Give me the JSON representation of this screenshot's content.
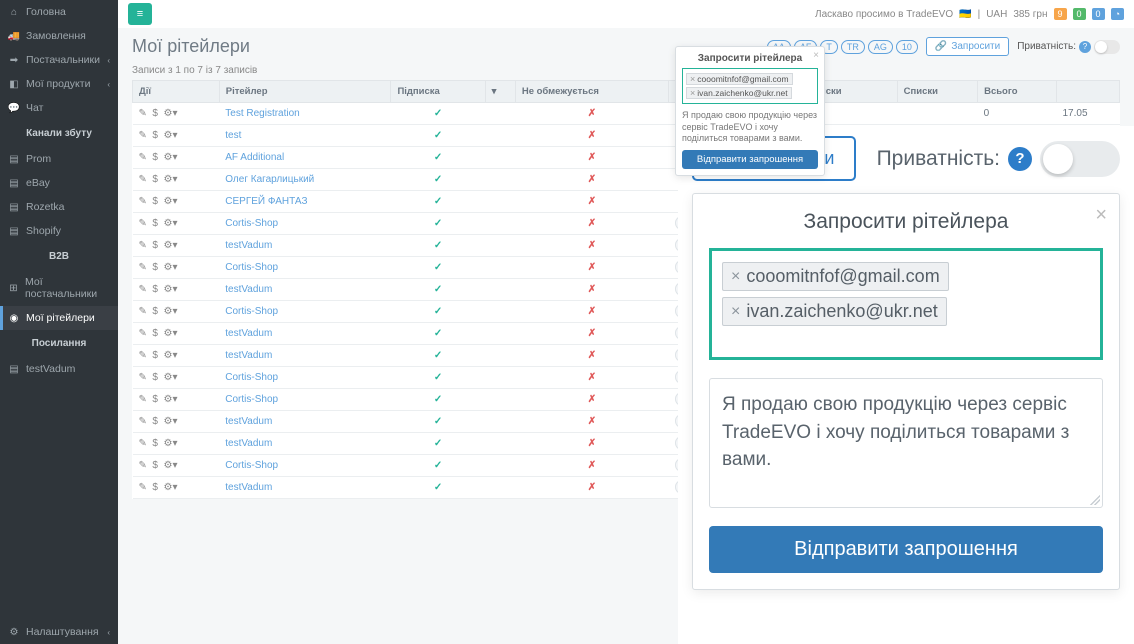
{
  "sidebar": {
    "items": [
      {
        "icon": "⌂",
        "label": "Головна"
      },
      {
        "icon": "🚚",
        "label": "Замовлення"
      },
      {
        "icon": "➡",
        "label": "Постачальники",
        "chev": "‹"
      },
      {
        "icon": "◧",
        "label": "Мої продукти",
        "chev": "‹"
      },
      {
        "icon": "💬",
        "label": "Чат"
      }
    ],
    "header1": "Канали збуту",
    "channels": [
      {
        "icon": "▤",
        "label": "Prom"
      },
      {
        "icon": "▤",
        "label": "eBay"
      },
      {
        "icon": "▤",
        "label": "Rozetka"
      },
      {
        "icon": "▤",
        "label": "Shopify"
      }
    ],
    "header2": "B2B",
    "b2b": [
      {
        "icon": "⊞",
        "label": "Мої постачальники"
      },
      {
        "icon": "◉",
        "label": "Мої рітейлери",
        "active": true
      }
    ],
    "header3": "Посилання",
    "links": [
      {
        "icon": "▤",
        "label": "testVadum"
      }
    ],
    "bottom": {
      "icon": "⚙",
      "label": "Налаштування",
      "chev": "‹"
    }
  },
  "topbar": {
    "welcome": "Ласкаво просимо в TradeEVO",
    "flag": "🇺🇦",
    "currency": "UAH",
    "amount": "385 грн",
    "notifs": [
      "9",
      "0",
      "0"
    ]
  },
  "page": {
    "title": "Мої рітейлери",
    "chips": [
      "AA",
      "AF",
      "T",
      "TR",
      "AG",
      "10"
    ],
    "invite_btn": "Запросити",
    "privacy_label": "Приватність:",
    "records": "Записи з 1 по 7 із 7 записів"
  },
  "table": {
    "headers": [
      "Дії",
      "Рітейлер",
      "Підписка",
      "",
      "Не обмежується",
      "",
      "",
      "тів в списки",
      "Списки",
      "Всього",
      ""
    ],
    "rows": [
      {
        "r": "Test Registration",
        "sub": true,
        "lim": false
      },
      {
        "r": "test",
        "sub": true,
        "lim": false
      },
      {
        "r": "AF Additional",
        "sub": true,
        "lim": false
      },
      {
        "r": "Олег Кагарлицький",
        "sub": true,
        "lim": false
      },
      {
        "r": "СЕРГЕЙ ФАНТАЗ",
        "sub": true,
        "lim": false
      },
      {
        "r": "Cortis-Shop",
        "sub": true,
        "lim": false,
        "tag": "Prom"
      },
      {
        "r": "testVadum",
        "sub": true,
        "lim": false,
        "tag": "Prom"
      },
      {
        "r": "Cortis-Shop",
        "sub": true,
        "lim": false,
        "tag": "Prom"
      },
      {
        "r": "testVadum",
        "sub": true,
        "lim": false,
        "tag": "Prom"
      },
      {
        "r": "Cortis-Shop",
        "sub": true,
        "lim": false,
        "tag": "Prom"
      },
      {
        "r": "testVadum",
        "sub": true,
        "lim": false,
        "tag": "Prom"
      },
      {
        "r": "testVadum",
        "sub": true,
        "lim": false,
        "tag": "Prom"
      },
      {
        "r": "Cortis-Shop",
        "sub": true,
        "lim": false,
        "tag": "Prom"
      },
      {
        "r": "Cortis-Shop",
        "sub": true,
        "lim": false,
        "tag": "Prom"
      },
      {
        "r": "testVadum",
        "sub": true,
        "lim": false,
        "tag": "Prom"
      },
      {
        "r": "testVadum",
        "sub": true,
        "lim": false,
        "tag": "Prom"
      },
      {
        "r": "Cortis-Shop",
        "sub": true,
        "lim": false,
        "tag": "Prom"
      },
      {
        "r": "testVadum",
        "sub": true,
        "lim": false,
        "tag": "Prom"
      }
    ],
    "summary": {
      "c1": "0",
      "c2": "17.05"
    }
  },
  "modal_sm": {
    "title": "Запросити рітейлера",
    "emails": [
      "cooomitnfof@gmail.com",
      "ivan.zaichenko@ukr.net"
    ],
    "desc": "Я продаю свою продукцію через сервіс TradeEVO і хочу поділиться товарами з вами.",
    "send": "Відправити запрошення"
  },
  "overlay": {
    "invite_btn": "Запросити",
    "privacy_label": "Приватність:",
    "modal": {
      "title": "Запросити рітейлера",
      "emails": [
        "cooomitnfof@gmail.com",
        "ivan.zaichenko@ukr.net"
      ],
      "msg": "Я продаю свою продукцію через сервіс TradeEVO і хочу поділиться товарами з вами.",
      "send": "Відправити запрошення"
    }
  }
}
